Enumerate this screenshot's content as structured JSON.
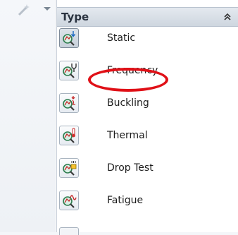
{
  "panel": {
    "title": "Type",
    "collapse_icon": "double-chevron-up-icon"
  },
  "gutter": {
    "tool_icon": "wand-icon",
    "dropdown_icon": "caret-down-icon"
  },
  "study_types": [
    {
      "label": "Static",
      "icon": "static-study-icon",
      "selected": true
    },
    {
      "label": "Frequency",
      "icon": "frequency-study-icon",
      "selected": false,
      "circled": true
    },
    {
      "label": "Buckling",
      "icon": "buckling-study-icon",
      "selected": false
    },
    {
      "label": "Thermal",
      "icon": "thermal-study-icon",
      "selected": false
    },
    {
      "label": "Drop Test",
      "icon": "drop-test-study-icon",
      "selected": false
    },
    {
      "label": "Fatigue",
      "icon": "fatigue-study-icon",
      "selected": false
    }
  ],
  "colors": {
    "highlight": "#e01017",
    "header_bg": "#d8dee6",
    "text": "#1c1c1c"
  }
}
